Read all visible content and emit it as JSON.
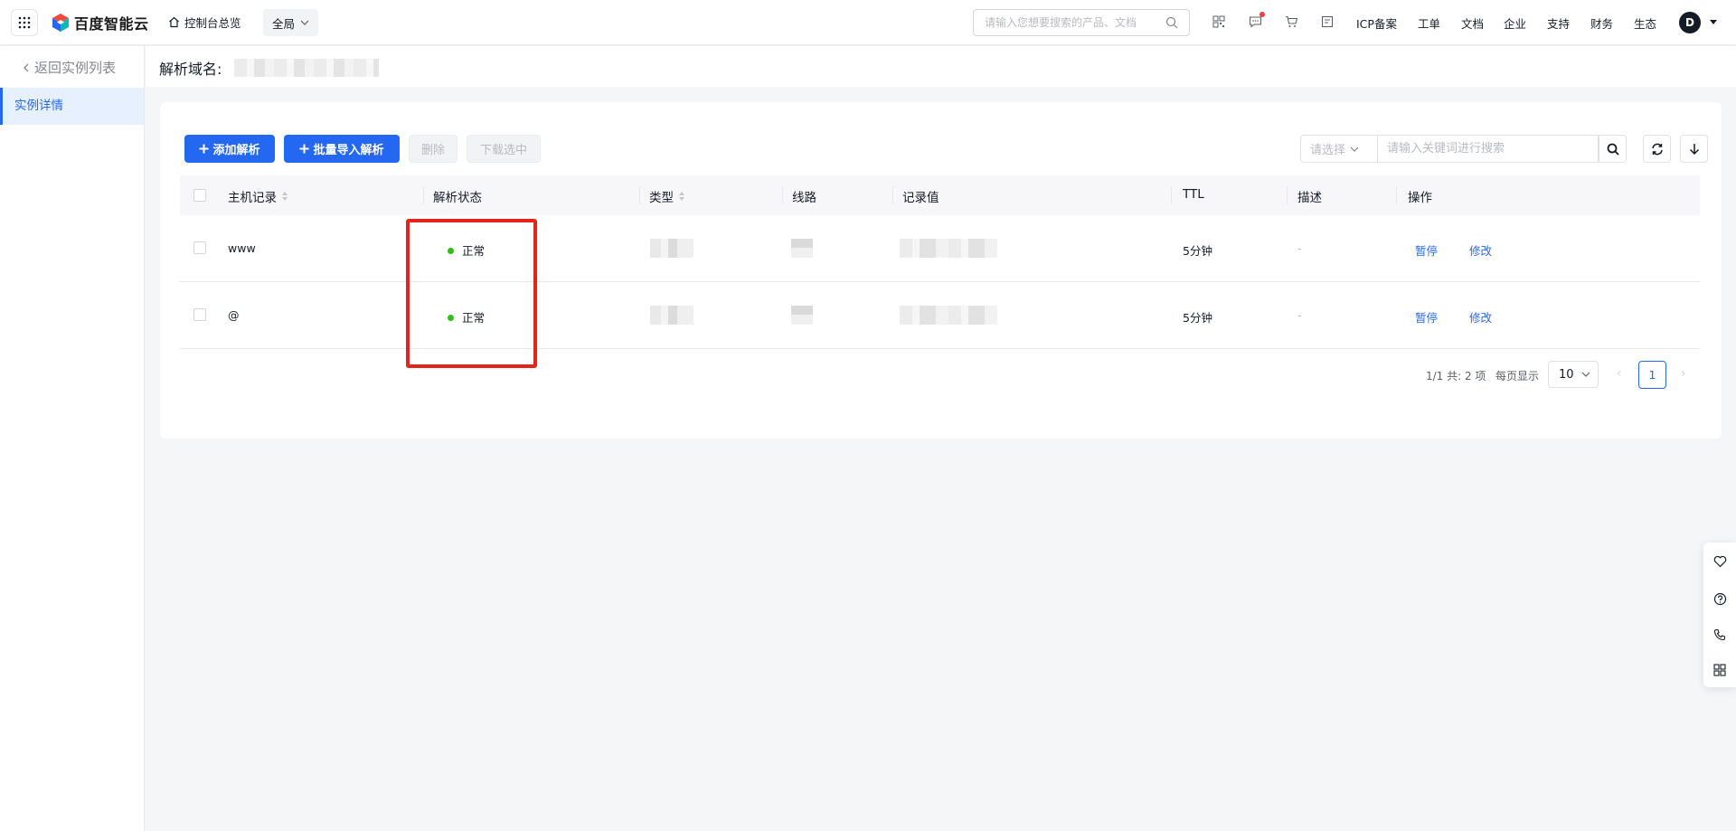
{
  "topbar": {
    "brand": "百度智能云",
    "home_label": "控制台总览",
    "region_label": "全局",
    "search_placeholder": "请输入您想要搜索的产品、文档",
    "nav_items": [
      "ICP备案",
      "工单",
      "文档",
      "企业",
      "支持",
      "财务",
      "生态"
    ],
    "avatar_letter": "D",
    "icons": [
      "apps-icon",
      "qrcode-icon",
      "message-icon",
      "cart-icon",
      "bill-icon"
    ]
  },
  "sidebar": {
    "back_label": "返回实例列表",
    "items": [
      {
        "label": "实例详情",
        "active": true
      }
    ]
  },
  "header": {
    "title": "解析域名:"
  },
  "toolbar": {
    "add_label": "添加解析",
    "batch_import_label": "批量导入解析",
    "delete_label": "删除",
    "download_label": "下载选中",
    "filter_select_placeholder": "请选择",
    "filter_input_placeholder": "请输入关键词进行搜索"
  },
  "table": {
    "columns": [
      "主机记录",
      "解析状态",
      "类型",
      "线路",
      "记录值",
      "TTL",
      "描述",
      "操作"
    ],
    "rows": [
      {
        "host": "www",
        "status": "正常",
        "ttl": "5分钟",
        "description": "-",
        "actions": [
          "暂停",
          "修改"
        ]
      },
      {
        "host": "@",
        "status": "正常",
        "ttl": "5分钟",
        "description": "-",
        "actions": [
          "暂停",
          "修改"
        ]
      }
    ]
  },
  "pagination": {
    "info": "1/1 共: 2 项",
    "page_size_label": "每页显示",
    "page_size": "10",
    "current_page": "1"
  },
  "colors": {
    "primary": "#2468f2",
    "status_ok": "#30bf13",
    "highlight": "#e6231b"
  }
}
